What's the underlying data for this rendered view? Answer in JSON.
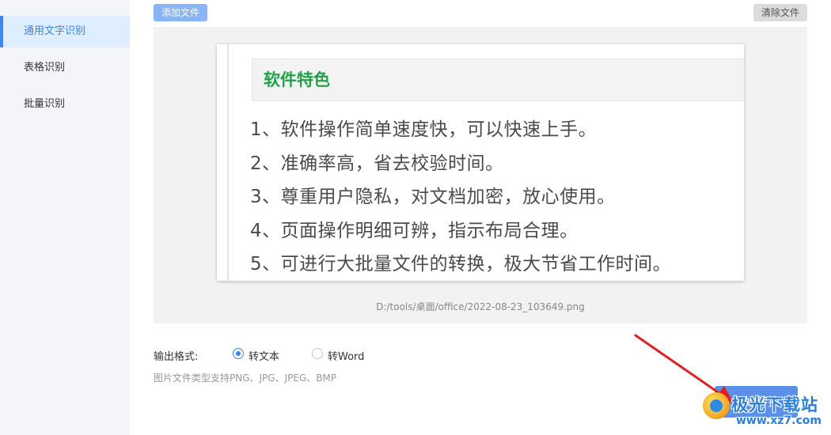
{
  "sidebar": {
    "items": [
      {
        "label": "通用文字识别",
        "active": true
      },
      {
        "label": "表格识别",
        "active": false
      },
      {
        "label": "批量识别",
        "active": false
      }
    ]
  },
  "toolbar": {
    "add_label": "添加文件",
    "clear_label": "清除文件"
  },
  "preview": {
    "image": {
      "title": "软件特色",
      "lines": [
        "1、软件操作简单速度快，可以快速上手。",
        "2、准确率高，省去校验时间。",
        "3、尊重用户隐私，对文档加密，放心使用。",
        "4、页面操作明细可辨，指示布局合理。",
        "5、可进行大批量文件的转换，极大节省工作时间。"
      ]
    },
    "file_path": "D:/tools/桌面/office/2022-08-23_103649.png"
  },
  "output": {
    "label": "输出格式:",
    "options": [
      {
        "label": "转文本",
        "checked": true
      },
      {
        "label": "转Word",
        "checked": false
      }
    ],
    "hint": "图片文件类型支持PNG、JPG、JPEG、BMP"
  },
  "start_label": "开始转换",
  "watermark": {
    "text": "极光下载站",
    "url": "www.xz7.com"
  },
  "colors": {
    "accent": "#3b86f0",
    "arrow": "#e02020",
    "feature_title": "#23a04a"
  }
}
